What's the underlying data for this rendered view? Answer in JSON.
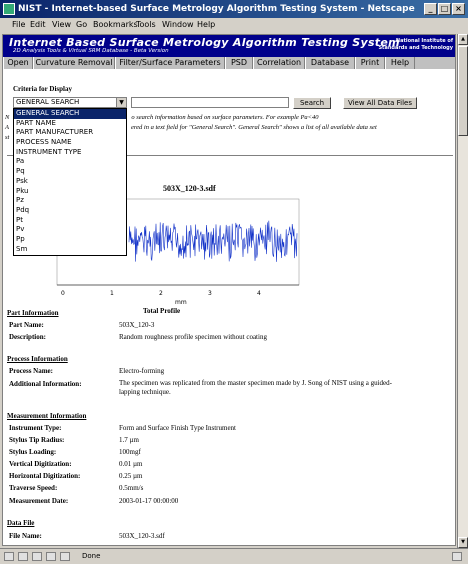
{
  "window": {
    "title": "NIST - Internet-based Surface Metrology Algorithm Testing System - Netscape"
  },
  "menu": [
    "File",
    "Edit",
    "View",
    "Go",
    "Bookmarks",
    "Tools",
    "Window",
    "Help"
  ],
  "banner": {
    "title": "Internet Based Surface Metrology Algorithm Testing System",
    "subtitle": "2D Analysis Tools & Virtual SRM Database - Beta Version",
    "institute_line1": "National Institute of",
    "institute_line2": "Standards and Technology"
  },
  "tabs": [
    "Open",
    "Curvature Removal",
    "Filter/Surface Parameters",
    "PSD",
    "Correlation",
    "Database",
    "Print",
    "Help"
  ],
  "criteria": {
    "label": "Criteria for Display",
    "selected": "GENERAL SEARCH",
    "search_value": "",
    "search_button": "Search",
    "view_all_button": "View All Data Files",
    "options": [
      "GENERAL SEARCH",
      "PART NAME",
      "PART MANUFACTURER",
      "PROCESS NAME",
      "INSTRUMENT TYPE",
      "Pa",
      "Pq",
      "Psk",
      "Pku",
      "Pz",
      "Pdq",
      "Pt",
      "Pv",
      "Pp",
      "Sm"
    ]
  },
  "help_text": {
    "line1_start": "N",
    "line1_rest": "o search information based on surface parameters. For example Pa<40",
    "line2_start": "A",
    "line2_rest": "ered in a text field for \"General Search\". General Search\" shows a list of all available data set",
    "line3": "st"
  },
  "plot": {
    "title": "503X_120-3.sdf",
    "unit": "mm",
    "xlabel": "Total Profile",
    "xticks": [
      "0",
      "1",
      "2",
      "3",
      "4"
    ]
  },
  "part_info": {
    "heading": "Part Information",
    "name_label": "Part Name:",
    "name_value": "503X_120-3",
    "desc_label": "Description:",
    "desc_value": "Random roughness profile specimen without coating"
  },
  "process_info": {
    "heading": "Process Information",
    "name_label": "Process Name:",
    "name_value": "Electro-forming",
    "add_label": "Additional Information:",
    "add_value": "The specimen was replicated from the master specimen made by J. Song of NIST using a guided-lapping technique."
  },
  "measurement_info": {
    "heading": "Measurement Information",
    "rows": [
      {
        "label": "Instrument Type:",
        "value": "Form and Surface Finish Type Instrument"
      },
      {
        "label": "Stylus Tip Radius:",
        "value": "1.7 µm"
      },
      {
        "label": "Stylus Loading:",
        "value": "100mgf"
      },
      {
        "label": "Vertical Digitization:",
        "value": "0.01 µm"
      },
      {
        "label": "Horizontal Digitization:",
        "value": "0.25 µm"
      },
      {
        "label": "Traverse Speed:",
        "value": "0.5mm/s"
      },
      {
        "label": "Measurement Date:",
        "value": "2003-01-17 00:00:00"
      }
    ]
  },
  "data_file": {
    "heading": "Data File",
    "label": "File Name:",
    "value": "503X_120-3.sdf"
  },
  "status": {
    "text": "Done"
  }
}
